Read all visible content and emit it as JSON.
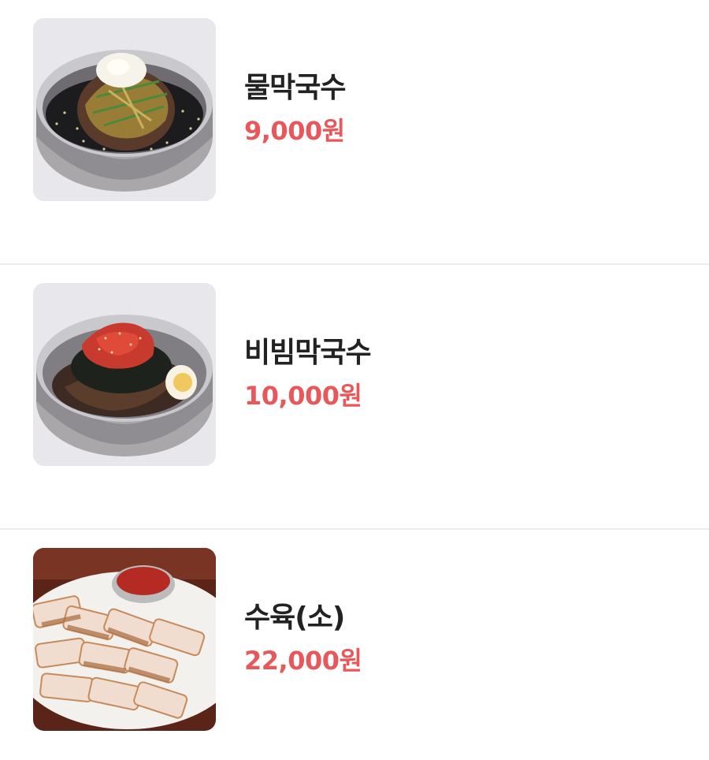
{
  "menu": {
    "items": [
      {
        "name": "물막국수",
        "price": "9,000원",
        "image": "cold-buckwheat-noodle-soup-image"
      },
      {
        "name": "비빔막국수",
        "price": "10,000원",
        "image": "spicy-buckwheat-noodle-image"
      },
      {
        "name": "수육(소)",
        "price": "22,000원",
        "image": "boiled-pork-slices-image"
      }
    ]
  },
  "colors": {
    "price": "#e8575a",
    "name": "#222222",
    "divider": "#ececec"
  }
}
